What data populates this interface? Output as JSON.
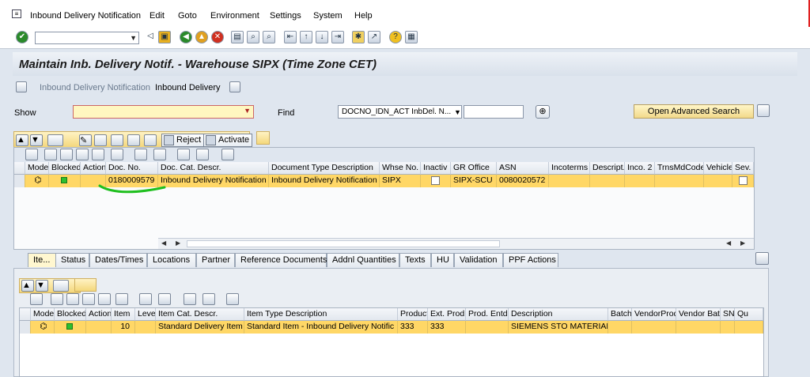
{
  "menu": {
    "items": [
      "Inbound Delivery Notification",
      "Edit",
      "Goto",
      "Environment",
      "Settings",
      "System",
      "Help"
    ]
  },
  "title": "Maintain Inb. Delivery Notif. - Warehouse SIPX (Time Zone CET)",
  "apptoolbar": {
    "item1": "Inbound Delivery Notification",
    "item2": "Inbound Delivery"
  },
  "search": {
    "show_label": "Show",
    "find_label": "Find",
    "find_value": "DOCNO_IDN_ACT InbDel. N...",
    "advanced_button": "Open Advanced Search"
  },
  "header_toolbar": {
    "reject": "Reject",
    "activate": "Activate"
  },
  "header_grid": {
    "columns": [
      "Mode",
      "Blocked",
      "Action",
      "Doc. No.",
      "Doc. Cat. Descr.",
      "Document Type Description",
      "Whse No.",
      "Inactiv",
      "GR Office",
      "ASN",
      "Incoterms",
      "Descript.",
      "Inco. 2",
      "TrnsMdCode",
      "Vehicle",
      "Sev. N"
    ],
    "row": {
      "doc_no": "0180009579",
      "doc_cat": "Inbound Delivery Notification",
      "doc_type": "Inbound Delivery Notification",
      "whse": "SIPX",
      "gr_office": "SIPX-SCU",
      "asn": "0080020572"
    }
  },
  "tabs": [
    "Ite...",
    "Status",
    "Dates/Times",
    "Locations",
    "Partner",
    "Reference Documents",
    "Addnl Quantities",
    "Texts",
    "HU",
    "Validation",
    "PPF Actions"
  ],
  "item_grid": {
    "columns": [
      "Mode",
      "Blocked",
      "Action",
      "Item",
      "Level",
      "Item Cat. Descr.",
      "Item Type Description",
      "Product",
      "Ext. Prod.",
      "Prod. Entd",
      "Description",
      "Batch",
      "VendorProd",
      "Vendor Bat",
      "SN",
      "Qu"
    ],
    "row": {
      "item": "10",
      "item_cat": "Standard Delivery Item",
      "item_type": "Standard Item - Inbound Delivery Notific",
      "product": "333",
      "ext_prod": "333",
      "description": "SIEMENS STO MATERIAL"
    }
  },
  "colors": {
    "highlight_row": "#ffd766",
    "status_green": "#2fbf2f",
    "annotation": "#1fbf1f"
  }
}
